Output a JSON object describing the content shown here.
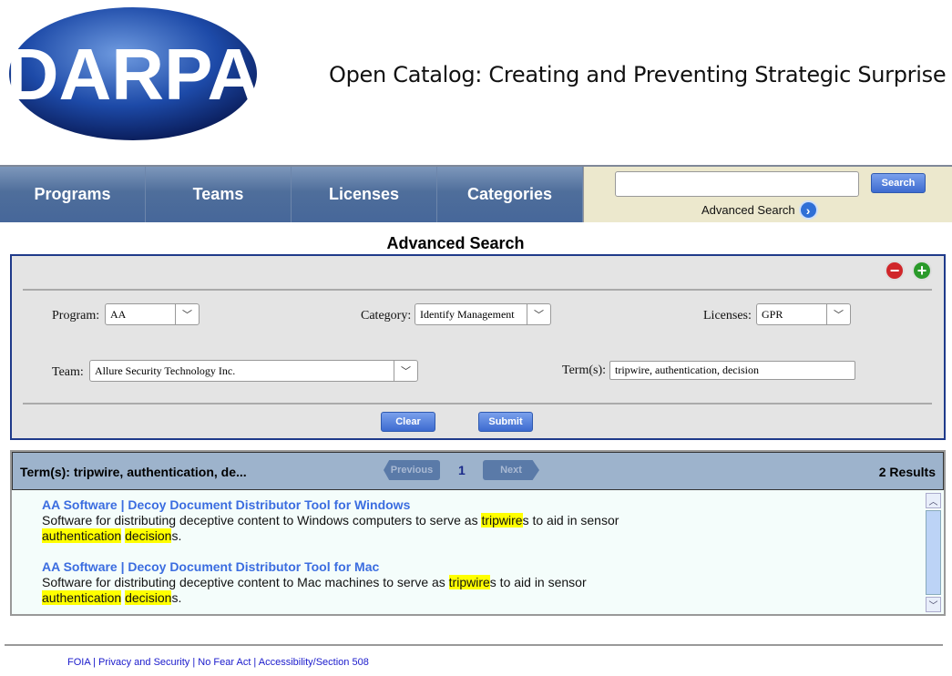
{
  "logo_text": "DARPA",
  "site_title": "Open Catalog: Creating and Preventing Strategic Surprise",
  "nav": [
    "Programs",
    "Teams",
    "Licenses",
    "Categories"
  ],
  "search": {
    "value": "",
    "button": "Search",
    "advanced_link": "Advanced Search"
  },
  "advanced": {
    "title": "Advanced Search",
    "program_label": "Program:",
    "program_value": "AA",
    "category_label": "Category:",
    "category_value": "Identify Management",
    "licenses_label": "Licenses:",
    "licenses_value": "GPR",
    "team_label": "Team:",
    "team_value": "Allure Security Technology Inc.",
    "terms_label": "Term(s):",
    "terms_value": "tripwire, authentication, decision",
    "clear": "Clear",
    "submit": "Submit"
  },
  "results": {
    "terms_summary": "Term(s): tripwire, authentication, de...",
    "previous": "Previous",
    "page": "1",
    "next": "Next",
    "count": "2 Results",
    "items": [
      {
        "title": "AA Software | Decoy Document Distributor Tool for Windows",
        "desc": [
          {
            "t": "Software for distributing deceptive content to Windows computers to serve as "
          },
          {
            "t": "tripwire",
            "h": true
          },
          {
            "t": "s to aid in sensor"
          },
          {
            "br": true
          },
          {
            "t": "authentication",
            "h": true
          },
          {
            "t": " "
          },
          {
            "t": "decision",
            "h": true
          },
          {
            "t": "s."
          }
        ]
      },
      {
        "title": "AA Software | Decoy Document Distributor Tool for Mac",
        "desc": [
          {
            "t": "Software for distributing deceptive content to Mac machines to serve as "
          },
          {
            "t": "tripwire",
            "h": true
          },
          {
            "t": "s to aid in sensor"
          },
          {
            "br": true
          },
          {
            "t": "authentication",
            "h": true
          },
          {
            "t": " "
          },
          {
            "t": "decision",
            "h": true
          },
          {
            "t": "s."
          }
        ]
      }
    ]
  },
  "footer": [
    "FOIA",
    "Privacy and Security",
    "No Fear Act",
    "Accessibility/Section 508"
  ]
}
